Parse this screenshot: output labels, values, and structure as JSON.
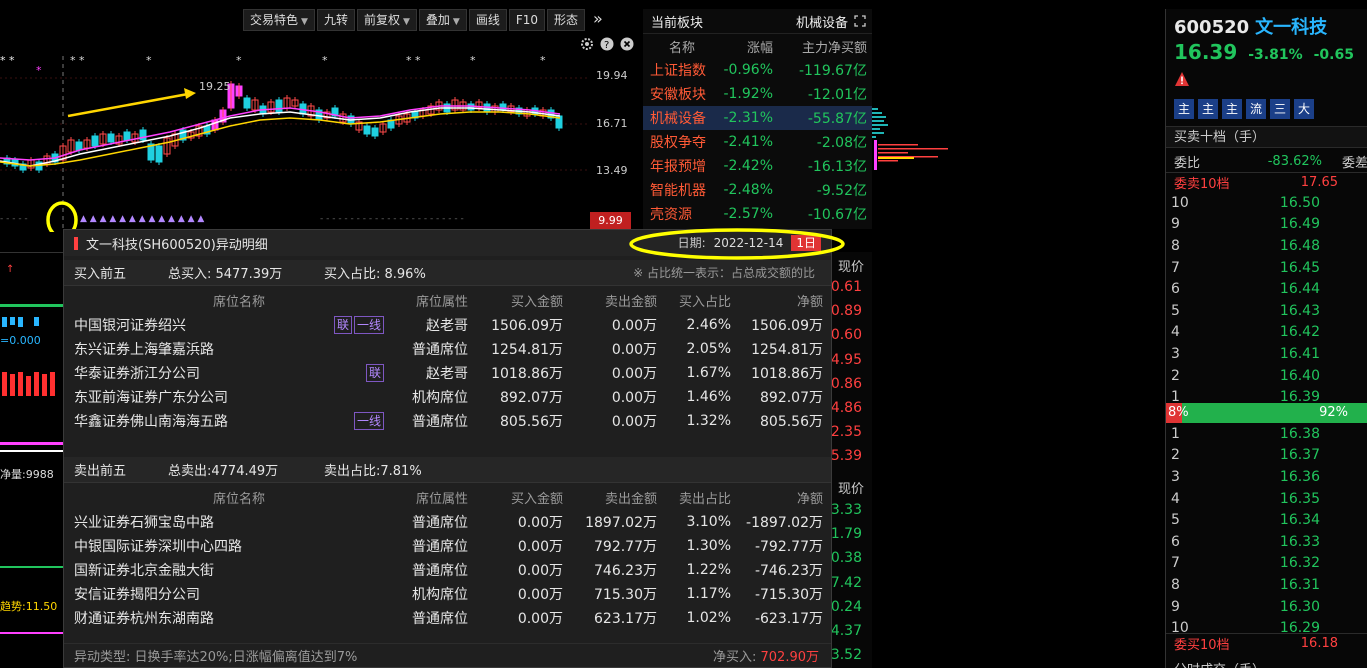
{
  "toolbar": {
    "buttons": [
      {
        "label": "交易特色",
        "caret": true
      },
      {
        "label": "九转",
        "caret": false
      },
      {
        "label": "前复权",
        "caret": true
      },
      {
        "label": "叠加",
        "caret": true
      },
      {
        "label": "画线",
        "caret": false
      },
      {
        "label": "F10",
        "caret": false
      },
      {
        "label": "形态",
        "caret": false
      }
    ],
    "more_icon": "double-chevron-right-icon"
  },
  "chart": {
    "price_labels": [
      "19.94",
      "16.71",
      "13.49"
    ],
    "last_price": "9.99",
    "peak_label": "19.25",
    "icons": [
      "settings-icon",
      "help-icon",
      "close-icon"
    ]
  },
  "left_strip": {
    "texts": [
      "=0.000",
      "净量:9988",
      "趋势:11.50"
    ]
  },
  "sector": {
    "title": "当前板块",
    "current": "机械设备",
    "columns": [
      "名称",
      "涨幅",
      "主力净买额"
    ],
    "rows": [
      {
        "name": "上证指数",
        "chg": "-0.96%",
        "net": "-119.67亿",
        "selected": false
      },
      {
        "name": "安徽板块",
        "chg": "-1.92%",
        "net": "-12.01亿",
        "selected": false
      },
      {
        "name": "机械设备",
        "chg": "-2.31%",
        "net": "-55.87亿",
        "selected": true
      },
      {
        "name": "股权争夺",
        "chg": "-2.41%",
        "net": "-2.08亿",
        "selected": false
      },
      {
        "name": "年报预增",
        "chg": "-2.42%",
        "net": "-16.13亿",
        "selected": false
      },
      {
        "name": "智能机器",
        "chg": "-2.48%",
        "net": "-9.52亿",
        "selected": false
      },
      {
        "name": "壳资源",
        "chg": "-2.57%",
        "net": "-10.67亿",
        "selected": false
      }
    ]
  },
  "stub": {
    "header1": "现价",
    "values1": [
      "0.61",
      "0.89",
      "0.60",
      "4.95",
      "0.86",
      "4.86",
      "2.35",
      "5.39"
    ],
    "header2": "现价",
    "values2": [
      "3.33",
      "1.79",
      "0.38",
      "7.42",
      "0.24",
      "4.37",
      "3.52"
    ]
  },
  "quote": {
    "code": "600520",
    "name": "文一科技",
    "price": "16.39",
    "chg_pct": "-3.81%",
    "chg": "-0.65",
    "tags": [
      "主",
      "主",
      "主",
      "流",
      "三",
      "大"
    ],
    "orderbook_title": "买卖十档（手）",
    "ratio_label": "委比",
    "ratio_value": "-83.62%",
    "diff_label": "委差",
    "sell_title": "委卖10档",
    "sell_title_price": "17.65",
    "sells": [
      {
        "lvl": "10",
        "px": "16.50"
      },
      {
        "lvl": "9",
        "px": "16.49"
      },
      {
        "lvl": "8",
        "px": "16.48"
      },
      {
        "lvl": "7",
        "px": "16.45"
      },
      {
        "lvl": "6",
        "px": "16.44"
      },
      {
        "lvl": "5",
        "px": "16.43"
      },
      {
        "lvl": "4",
        "px": "16.42"
      },
      {
        "lvl": "3",
        "px": "16.41"
      },
      {
        "lvl": "2",
        "px": "16.40"
      },
      {
        "lvl": "1",
        "px": "16.39"
      }
    ],
    "buy_pct": "8%",
    "sell_pct": "92%",
    "buy_ratio": 0.08,
    "buys": [
      {
        "lvl": "1",
        "px": "16.38"
      },
      {
        "lvl": "2",
        "px": "16.37"
      },
      {
        "lvl": "3",
        "px": "16.36"
      },
      {
        "lvl": "4",
        "px": "16.35"
      },
      {
        "lvl": "5",
        "px": "16.34"
      },
      {
        "lvl": "6",
        "px": "16.33"
      },
      {
        "lvl": "7",
        "px": "16.32"
      },
      {
        "lvl": "8",
        "px": "16.31"
      },
      {
        "lvl": "9",
        "px": "16.30"
      },
      {
        "lvl": "10",
        "px": "16.29"
      }
    ],
    "buy_title": "委买10档",
    "buy_title_price": "16.18",
    "bottom_label": "分时成交（手）"
  },
  "popup": {
    "title": "文一科技(SH600520)异动明细",
    "date_label": "日期:",
    "date_value": "2022-12-14",
    "period_btn": "1日",
    "buy_section": {
      "label": "买入前五",
      "total": "总买入: 5477.39万",
      "ratio": "买入占比: 8.96%",
      "note": "※ 占比统一表示：占总成交额的比"
    },
    "buy_columns": [
      "席位名称",
      "席位属性",
      "买入金额",
      "卖出金额",
      "买入占比",
      "净额"
    ],
    "buy_rows": [
      {
        "name": "中国银河证券绍兴",
        "badges": [
          "联",
          "一线"
        ],
        "attr": "赵老哥",
        "buy": "1506.09万",
        "sell": "0.00万",
        "ratio": "2.46%",
        "net": "1506.09万"
      },
      {
        "name": "东兴证券上海肇嘉浜路",
        "badges": [],
        "attr": "普通席位",
        "buy": "1254.81万",
        "sell": "0.00万",
        "ratio": "2.05%",
        "net": "1254.81万"
      },
      {
        "name": "华泰证券浙江分公司",
        "badges": [
          "联"
        ],
        "attr": "赵老哥",
        "buy": "1018.86万",
        "sell": "0.00万",
        "ratio": "1.67%",
        "net": "1018.86万"
      },
      {
        "name": "东亚前海证券广东分公司",
        "badges": [],
        "attr": "机构席位",
        "buy": "892.07万",
        "sell": "0.00万",
        "ratio": "1.46%",
        "net": "892.07万"
      },
      {
        "name": "华鑫证券佛山南海海五路",
        "badges": [
          "一线"
        ],
        "attr": "普通席位",
        "buy": "805.56万",
        "sell": "0.00万",
        "ratio": "1.32%",
        "net": "805.56万"
      }
    ],
    "sell_section": {
      "label": "卖出前五",
      "total": "总卖出:4774.49万",
      "ratio": "卖出占比:7.81%"
    },
    "sell_columns": [
      "席位名称",
      "席位属性",
      "买入金额",
      "卖出金额",
      "卖出占比",
      "净额"
    ],
    "sell_rows": [
      {
        "name": "兴业证券石狮宝岛中路",
        "attr": "普通席位",
        "buy": "0.00万",
        "sell": "1897.02万",
        "ratio": "3.10%",
        "net": "-1897.02万"
      },
      {
        "name": "中银国际证券深圳中心四路",
        "attr": "普通席位",
        "buy": "0.00万",
        "sell": "792.77万",
        "ratio": "1.30%",
        "net": "-792.77万"
      },
      {
        "name": "国新证券北京金融大街",
        "attr": "普通席位",
        "buy": "0.00万",
        "sell": "746.23万",
        "ratio": "1.22%",
        "net": "-746.23万"
      },
      {
        "name": "安信证券揭阳分公司",
        "attr": "机构席位",
        "buy": "0.00万",
        "sell": "715.30万",
        "ratio": "1.17%",
        "net": "-715.30万"
      },
      {
        "name": "财通证券杭州东湖南路",
        "attr": "普通席位",
        "buy": "0.00万",
        "sell": "623.17万",
        "ratio": "1.02%",
        "net": "-623.17万"
      }
    ],
    "footer_type": "异动类型: 日换手率达20%;日涨幅偏离值达到7%",
    "footer_net_label": "净买入:",
    "footer_net_value": "702.90万"
  }
}
